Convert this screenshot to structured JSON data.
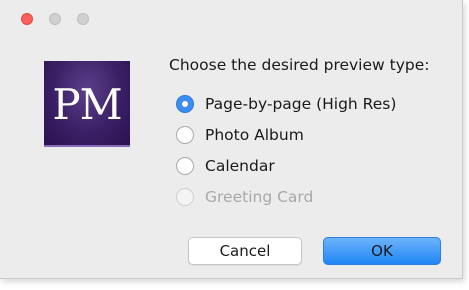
{
  "window": {
    "traffic_lights": [
      "close",
      "minimize",
      "zoom"
    ]
  },
  "logo": {
    "text": "PM"
  },
  "dialog": {
    "prompt": "Choose the desired preview type:",
    "options": [
      {
        "label": "Page-by-page (High Res)",
        "selected": true,
        "enabled": true
      },
      {
        "label": "Photo Album",
        "selected": false,
        "enabled": true
      },
      {
        "label": "Calendar",
        "selected": false,
        "enabled": true
      },
      {
        "label": "Greeting Card",
        "selected": false,
        "enabled": false
      }
    ],
    "cancel_label": "Cancel",
    "ok_label": "OK"
  },
  "colors": {
    "accent": "#3b8ef0",
    "close": "#fc605c",
    "logo_bg": "#3b1f66"
  }
}
